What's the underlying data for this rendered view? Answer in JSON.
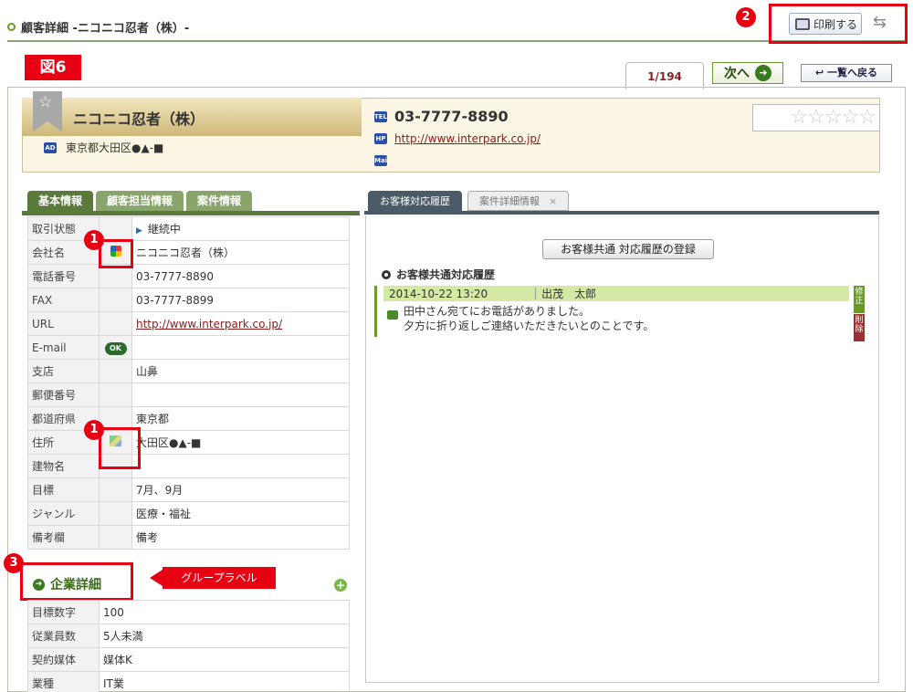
{
  "header": {
    "title": "顧客詳細 -ニコニコ忍者（株）-",
    "print_label": "印刷する"
  },
  "figure_label": "図6",
  "badges": {
    "one": "1",
    "two": "2",
    "three": "3"
  },
  "nav": {
    "page_count": "1/194",
    "next_label": "次へ",
    "back_label": "一覧へ戻る"
  },
  "customer": {
    "name": "ニコニコ忍者（株）",
    "address": "東京都大田区●▲-■",
    "tel": "03-7777-8890",
    "url": "http://www.interpark.co.jp/",
    "rating_stars": "☆☆☆☆☆",
    "icons": {
      "ad": "AD",
      "tel": "TEL",
      "hp": "HP",
      "mail": "Mail"
    }
  },
  "left_tabs": [
    "基本情報",
    "顧客担当情報",
    "案件情報"
  ],
  "right_tabs": [
    "お客様対応履歴",
    "案件詳細情報"
  ],
  "basic_info": [
    {
      "label": "取引状態",
      "value": "継続中"
    },
    {
      "label": "会社名",
      "value": "ニコニコ忍者（株）"
    },
    {
      "label": "電話番号",
      "value": "03-7777-8890"
    },
    {
      "label": "FAX",
      "value": "03-7777-8899"
    },
    {
      "label": "URL",
      "value": "http://www.interpark.co.jp/"
    },
    {
      "label": "E-mail",
      "value": ""
    },
    {
      "label": "支店",
      "value": "山鼻"
    },
    {
      "label": "郵便番号",
      "value": ""
    },
    {
      "label": "都道府県",
      "value": "東京都"
    },
    {
      "label": "住所",
      "value": "大田区●▲-■"
    },
    {
      "label": "建物名",
      "value": ""
    },
    {
      "label": "目標",
      "value": "7月、9月"
    },
    {
      "label": "ジャンル",
      "value": "医療・福祉"
    },
    {
      "label": "備考欄",
      "value": "備考"
    }
  ],
  "email_badge": "OK",
  "group": {
    "title": "企業詳細",
    "callout": "グループラベル"
  },
  "company_detail": [
    {
      "label": "目標数字",
      "value": "100"
    },
    {
      "label": "従業員数",
      "value": "5人未満"
    },
    {
      "label": "契約媒体",
      "value": "媒体K"
    },
    {
      "label": "業種",
      "value": "IT業"
    }
  ],
  "history": {
    "register_button": "お客様共通 対応履歴の登録",
    "title": "お客様共通対応履歴",
    "entry": {
      "datetime": "2014-10-22 13:20",
      "staff": "出茂　太郎",
      "line1": "田中さん宛てにお電話がありました。",
      "line2": "夕方に折り返しご連絡いただきたいとのことです。",
      "edit_label": "修正",
      "delete_label": "削除"
    }
  }
}
